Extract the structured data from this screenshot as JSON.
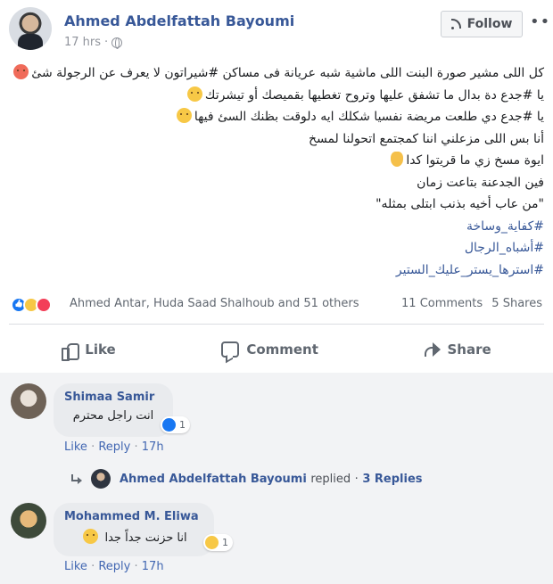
{
  "post": {
    "author": "Ahmed Abdelfattah Bayoumi",
    "time": "17 hrs",
    "follow_label": "Follow",
    "more_label": "•••",
    "lines": [
      {
        "text": "كل اللى مشير صورة البنت اللى ماشية شبه عريانة فى مساكن #شيراتون لا يعرف عن الرجولة شئ",
        "emoji": "angry-emoji"
      },
      {
        "text": "يا #جدع دة بدال ما تشفق عليها وتروح تغطيها بقميصك أو تيشرتك",
        "emoji": "smirk-emoji"
      },
      {
        "text": "يا #جدع دي طلعت مريضة نفسيا شكلك ايه دلوقت بظنك السئ فيها",
        "emoji": "sad-emoji"
      },
      {
        "text": "أنا بس اللى مزعلني اننا كمجتمع اتحولنا لمسخ",
        "emoji": ""
      },
      {
        "text": "ايوة مسخ زي ما قريتوا كدا",
        "emoji": "hand-emoji"
      },
      {
        "text": "فين الجدعنة بتاعت زمان",
        "emoji": ""
      },
      {
        "text": "\"من عاب أخيه بذنب ابتلى بمثله\"",
        "emoji": ""
      }
    ],
    "hashtags": [
      "#كفاية_وساخة",
      "#أشباه_الرجال",
      "#استرها_يستر_عليك_الستير"
    ]
  },
  "reactions": {
    "names": "Ahmed Antar, Huda Saad Shalhoub and 51 others",
    "comments": "11 Comments",
    "shares": "5 Shares"
  },
  "actions": {
    "like": "Like",
    "comment": "Comment",
    "share": "Share"
  },
  "comments": [
    {
      "name": "Shimaa Samir",
      "text": "انت راجل محترم",
      "reaction_count": "1",
      "like": "Like",
      "reply": "Reply",
      "time": "17h",
      "sep": "·"
    },
    {
      "name": "Mohammed M. Eliwa",
      "text": "انا حزنت جداً جدا",
      "reaction_count": "1",
      "like": "Like",
      "reply": "Reply",
      "time": "17h",
      "sep": "·"
    }
  ],
  "reply_summary": {
    "author": "Ahmed Abdelfattah Bayoumi",
    "replied": "replied",
    "sep": "·",
    "count": "3 Replies"
  }
}
